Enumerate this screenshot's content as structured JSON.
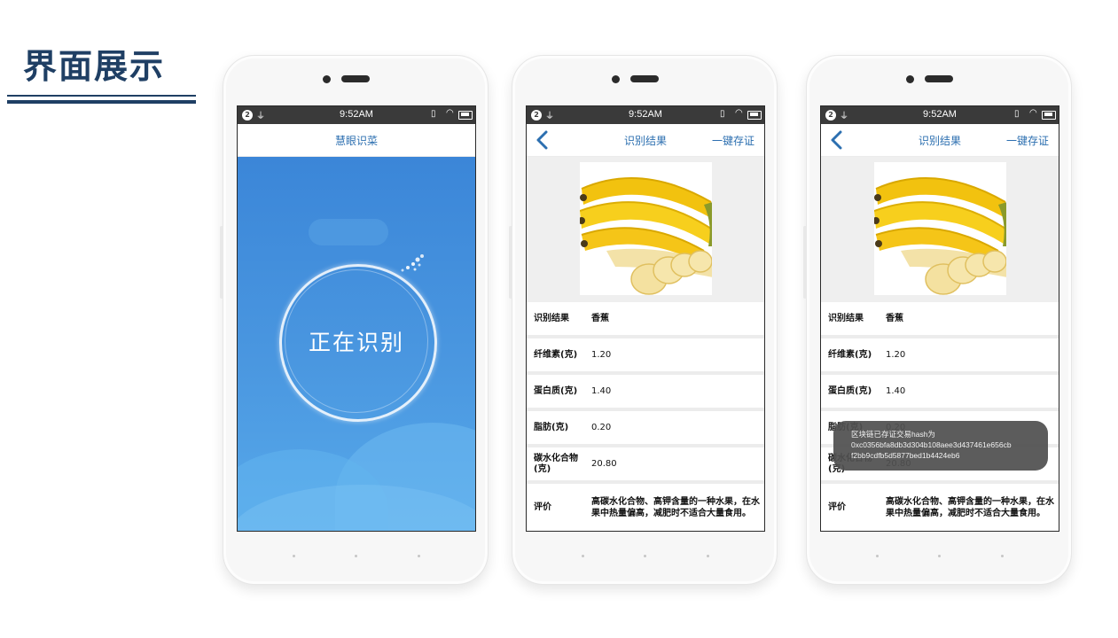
{
  "slide": {
    "title": "界面展示"
  },
  "status_bar": {
    "time": "9:52AM",
    "notification_count": "2"
  },
  "screen1": {
    "app_title": "慧眼识菜",
    "scanning_text": "正在识别"
  },
  "result": {
    "app_title": "识别结果",
    "save_action": "一键存证",
    "rows": [
      {
        "label": "识别结果",
        "value": "香蕉"
      },
      {
        "label": "纤维素(克)",
        "value": "1.20"
      },
      {
        "label": "蛋白质(克)",
        "value": "1.40"
      },
      {
        "label": "脂肪(克)",
        "value": "0.20"
      },
      {
        "label": "碳水化合物(克)",
        "value": "20.80"
      },
      {
        "label": "评价",
        "value": "高碳水化合物、高钾含量的一种水果，在水果中热量偏高，减肥时不适合大量食用。"
      }
    ]
  },
  "toast": {
    "line1": "区块链已存证交易hash为",
    "line2": "0xc0356bfa8db3d304b108aee3d437461e656cb",
    "line3": "f2bb9cdfb5d5877bed1b4424eb6"
  },
  "colors": {
    "accent": "#2c6fb0",
    "title": "#1f3f64",
    "scan_blue": "#3b86d8",
    "banana_yellow": "#f5c518"
  }
}
